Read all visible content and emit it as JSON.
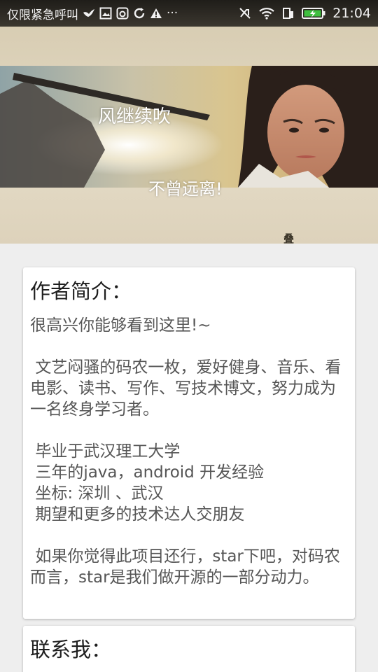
{
  "status_bar": {
    "carrier_text": "仅限紧急呼叫",
    "more_indicator": "···",
    "time": "21:04",
    "icons_left": [
      "bird-icon",
      "image-icon",
      "camera-icon",
      "sync-icon",
      "warning-icon"
    ],
    "icons_right": [
      "mute-icon",
      "wifi-icon",
      "sim-icon",
      "battery-charging-icon"
    ]
  },
  "header": {
    "banner_title": "风继续吹",
    "banner_subtitle": "不曾远离!",
    "seal_text": "叠"
  },
  "intro_card": {
    "title": "作者简介：",
    "body": "很高兴你能够看到这里!~\n\n 文艺闷骚的码农一枚，爱好健身、音乐、看电影、读书、写作、写技术博文，努力成为一名终身学习者。\n\n 毕业于武汉理工大学\n 三年的java，android 开发经验\n 坐标: 深圳 、武汉\n 期望和更多的技术达人交朋友\n\n 如果你觉得此项目还行，star下吧，对码农而言，star是我们做开源的一部分动力。"
  },
  "contact_card": {
    "title": "联系我："
  }
}
